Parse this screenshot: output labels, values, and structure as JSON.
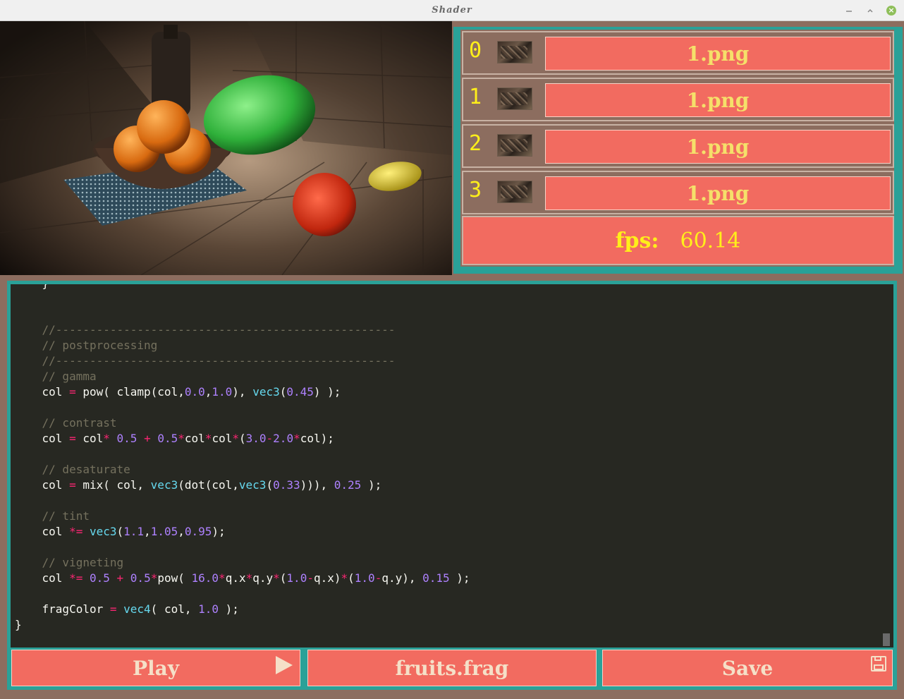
{
  "window": {
    "title": "Shader"
  },
  "channels": [
    {
      "index": "0",
      "file": "1.png"
    },
    {
      "index": "1",
      "file": "1.png"
    },
    {
      "index": "2",
      "file": "1.png"
    },
    {
      "index": "3",
      "file": "1.png"
    }
  ],
  "stats": {
    "fps_label": "fps:",
    "fps_value": "60.14"
  },
  "toolbar": {
    "play_label": "Play",
    "file_label": "fruits.frag",
    "save_label": "Save"
  },
  "icons": {
    "play": "play-icon",
    "save": "floppy-disk-icon",
    "minimize": "minimize-icon",
    "restore": "restore-icon",
    "close": "close-icon"
  },
  "colors": {
    "teal": "#2aa198",
    "coral": "#f26b60",
    "brown": "#8c6d5f",
    "yellow": "#ffef1a",
    "editor_bg": "#272822"
  }
}
